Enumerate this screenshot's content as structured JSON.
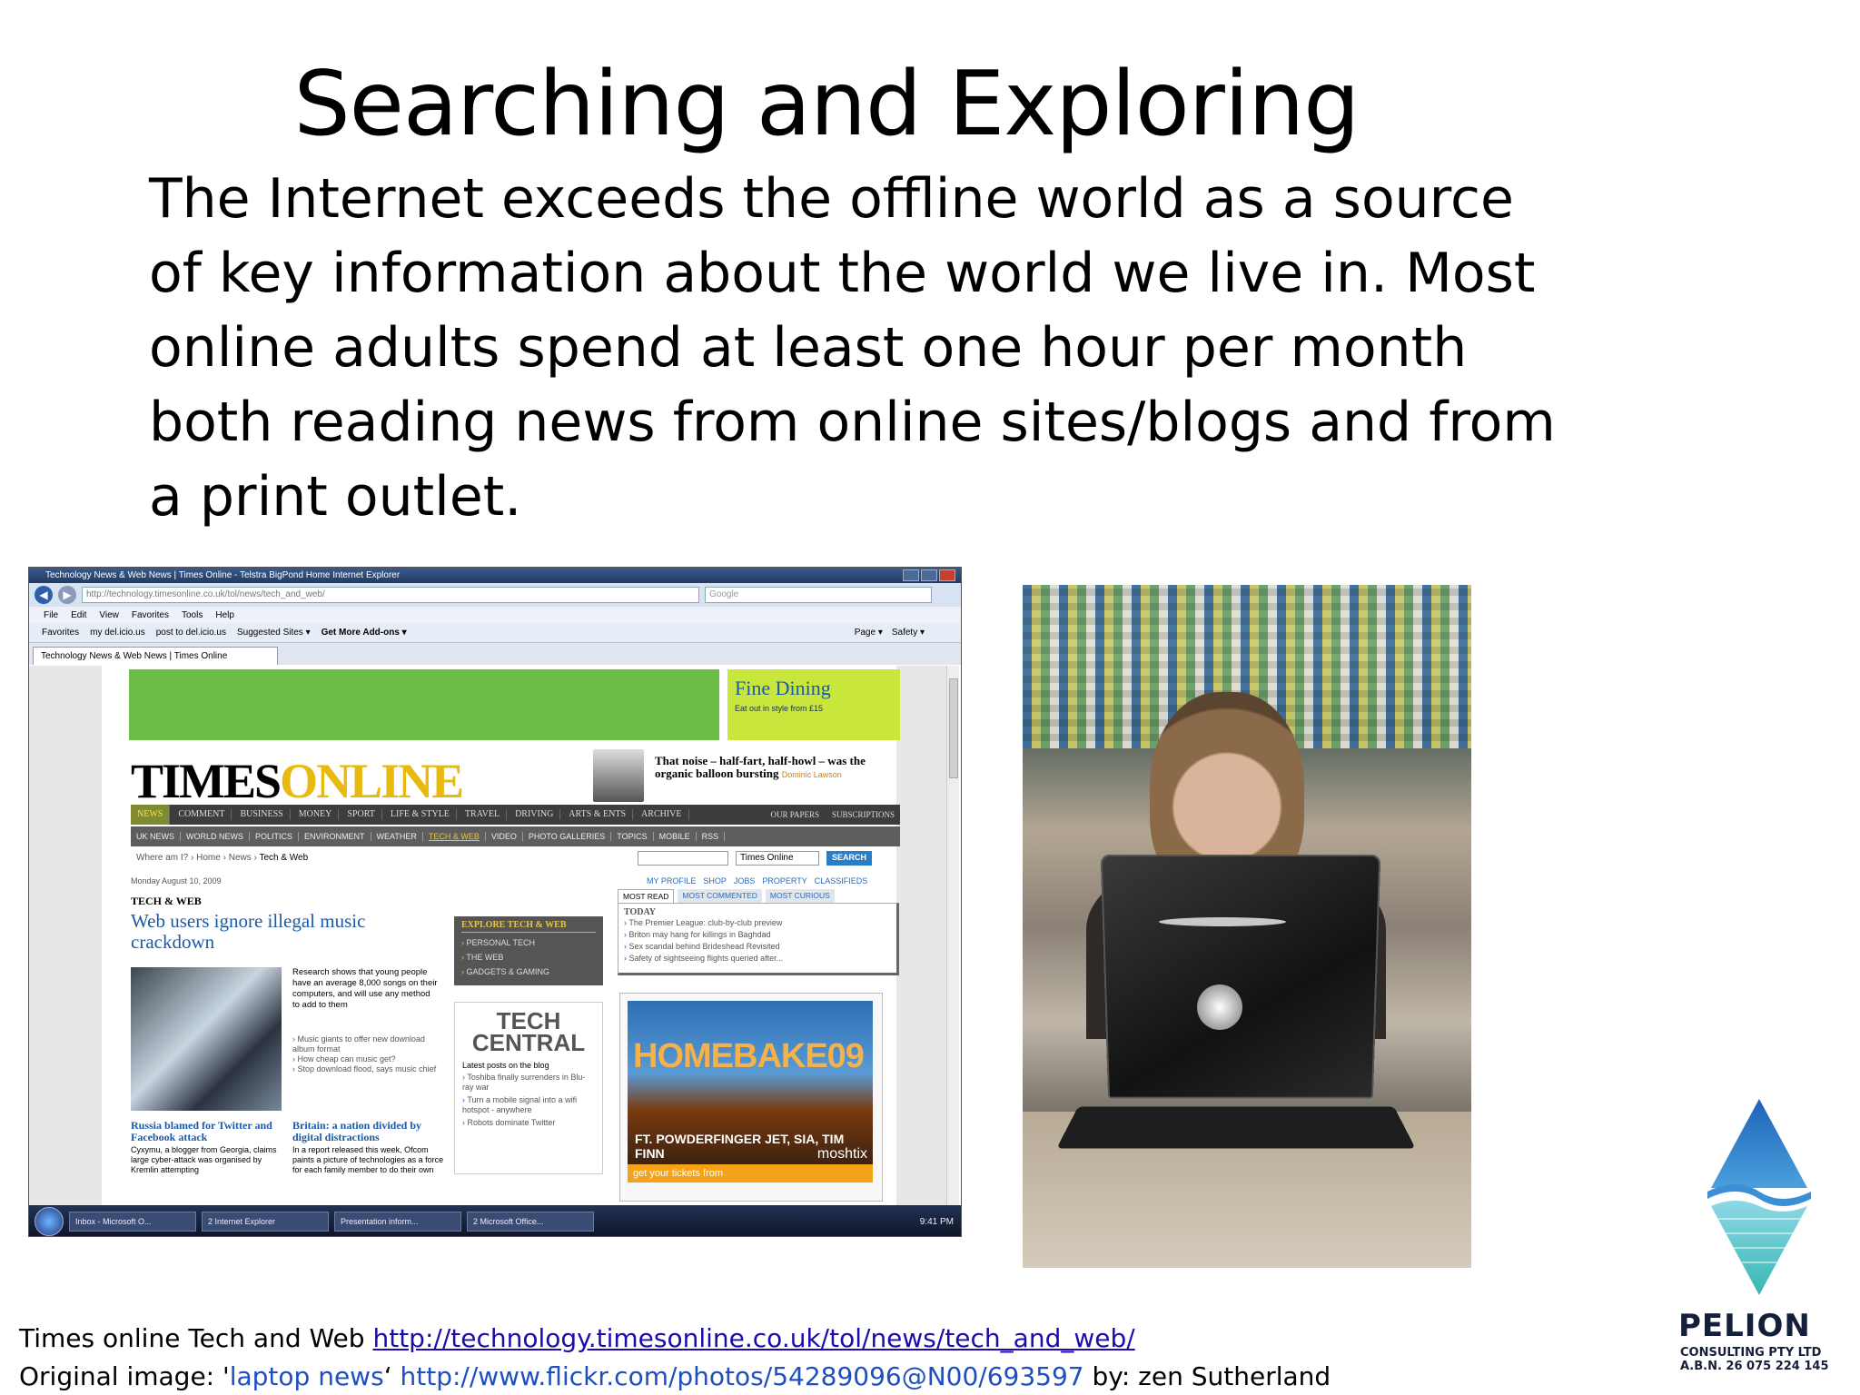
{
  "slide": {
    "title": "Searching and Exploring",
    "body": "The Internet exceeds the offline world as a source of key information about the world we live in.  Most online adults spend at least one hour per month both reading news from online sites/blogs and from a print outlet."
  },
  "browser": {
    "window_title": "Technology News & Web News | Times Online - Telstra BigPond Home Internet Explorer",
    "url": "http://technology.timesonline.co.uk/tol/news/tech_and_web/",
    "search_placeholder": "Google",
    "menu": [
      "File",
      "Edit",
      "View",
      "Favorites",
      "Tools",
      "Help"
    ],
    "favorites_bar": [
      "Favorites",
      "my del.icio.us",
      "post to del.icio.us",
      "Suggested Sites ▾",
      "Get More Add-ons ▾"
    ],
    "command_bar": [
      "Page ▾",
      "Safety ▾"
    ],
    "tab_label": "Technology News & Web News | Times Online"
  },
  "site": {
    "ad": {
      "title": "Fine Dining",
      "subtitle": "Eat out in style from £15"
    },
    "logo": {
      "part1": "TIMES",
      "part2": "ONLINE"
    },
    "quote": {
      "text": "That noise – half-fart, half-howl – was the organic balloon bursting",
      "author": "Dominic Lawson"
    },
    "nav_primary": [
      "NEWS",
      "COMMENT",
      "BUSINESS",
      "MONEY",
      "SPORT",
      "LIFE & STYLE",
      "TRAVEL",
      "DRIVING",
      "ARTS & ENTS",
      "ARCHIVE"
    ],
    "nav_primary_right": [
      "OUR PAPERS",
      "SUBSCRIPTIONS"
    ],
    "nav_secondary": [
      "UK NEWS",
      "WORLD NEWS",
      "POLITICS",
      "ENVIRONMENT",
      "WEATHER",
      "TECH & WEB",
      "VIDEO",
      "PHOTO GALLERIES",
      "TOPICS",
      "MOBILE",
      "RSS"
    ],
    "breadcrumb": {
      "prefix": "Where am I?",
      "home": "Home",
      "news": "News",
      "current": "Tech & Web"
    },
    "search_scope": "Times Online",
    "search_button": "SEARCH",
    "date": "Monday August 10, 2009",
    "top_links": [
      "MY PROFILE",
      "SHOP",
      "JOBS",
      "PROPERTY",
      "CLASSIFIEDS"
    ],
    "section_label": "TECH & WEB",
    "lead": {
      "headline": "Web users ignore illegal music crackdown",
      "summary": "Research shows that young people have an average 8,000 songs on their computers, and will use any method to add to them",
      "related": [
        "Music giants to offer new download album format",
        "How cheap can music get?",
        "Stop download flood, says music chief"
      ]
    },
    "story2": {
      "headline": "Russia blamed for Twitter and Facebook attack",
      "text": "Cyxymu, a blogger from Georgia, claims large cyber-attack was organised by Kremlin attempting"
    },
    "story3": {
      "headline": "Britain: a nation divided by digital distractions",
      "text": "In a report released this week, Ofcom paints a picture of technologies as a force for each family member to do their own"
    },
    "explore": {
      "title": "EXPLORE TECH & WEB",
      "items": [
        "PERSONAL TECH",
        "THE WEB",
        "GADGETS & GAMING"
      ]
    },
    "tech_central": {
      "logo": "TECH CENTRAL",
      "subtitle": "Latest posts on the blog",
      "items": [
        "Toshiba finally surrenders in Blu-ray war",
        "Turn a mobile signal into a wifi hotspot - anywhere",
        "Robots dominate Twitter"
      ]
    },
    "most": {
      "tabs": [
        "MOST READ",
        "MOST COMMENTED",
        "MOST CURIOUS"
      ],
      "heading": "TODAY",
      "items": [
        "The Premier League: club-by-club preview",
        "Briton may hang for killings in Baghdad",
        "Sex scandal behind Brideshead Revisited",
        "Safety of sightseeing flights queried after..."
      ]
    },
    "promo": {
      "title": "HOMEBAKE09",
      "bands": "FT. POWDERFINGER JET, SIA, TIM FINN",
      "ticket_text": "get your tickets from",
      "brand": "moshtix"
    }
  },
  "taskbar": {
    "items": [
      "Inbox - Microsoft O...",
      "2 Internet Explorer",
      "Presentation inform...",
      "2 Microsoft Office..."
    ],
    "clock": "9:41 PM"
  },
  "caption": {
    "line1_text": "Times online Tech and Web ",
    "line1_link": "http://technology.timesonline.co.uk/tol/news/tech_and_web/",
    "line2_prefix": "Original image: '",
    "line2_title": "laptop news",
    "line2_mid": "‘   ",
    "line2_link": "http://www.flickr.com/photos/54289096@N00/693597",
    "line2_suffix": " by: zen Sutherland"
  },
  "branding": {
    "name": "PELION",
    "sub1": "CONSULTING PTY LTD",
    "sub2": "A.B.N. 26 075 224 145"
  }
}
